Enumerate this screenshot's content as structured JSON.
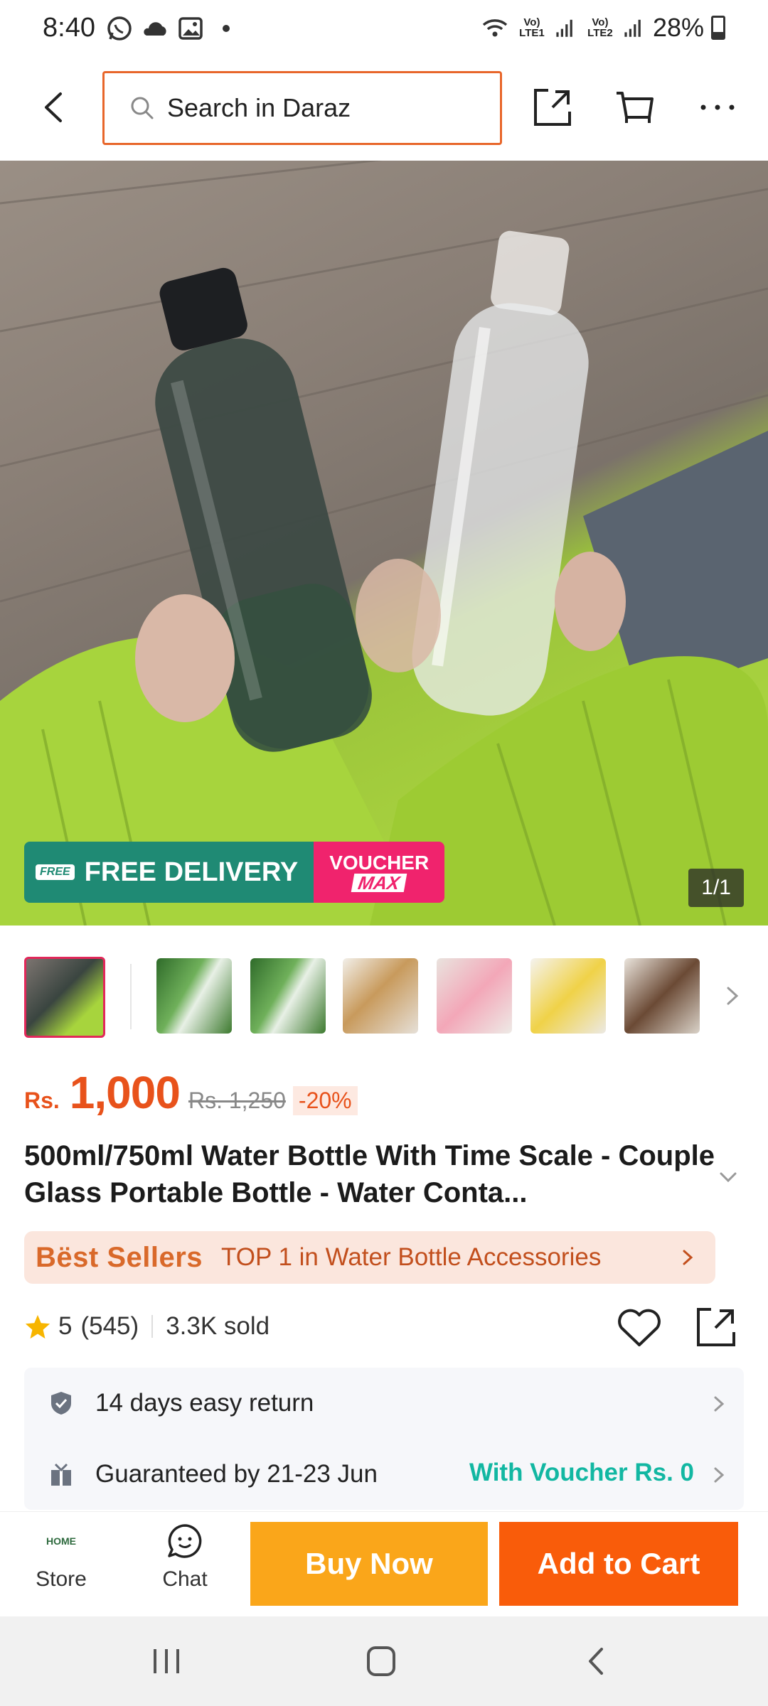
{
  "status_bar": {
    "time": "8:40",
    "battery_percent": "28%",
    "sim1_label": "Vo) LTE1",
    "sim2_label": "Vo) LTE2",
    "icons": [
      "whatsapp-icon",
      "cloud-icon",
      "gallery-icon",
      "dot-icon",
      "wifi-icon",
      "signal-icon",
      "battery-icon"
    ]
  },
  "header": {
    "search_placeholder": "Search in Daraz",
    "icons": [
      "back-icon",
      "search-icon",
      "share-icon",
      "cart-icon",
      "more-icon"
    ]
  },
  "product_image": {
    "banner_left": "FREE DELIVERY",
    "banner_free_tag": "FREE",
    "banner_voucher_line1": "VOUCHER",
    "banner_voucher_line2": "MAX",
    "counter": "1/1"
  },
  "price": {
    "currency": "Rs.",
    "current": "1,000",
    "original": "Rs. 1,250",
    "discount": "-20%"
  },
  "title": "500ml/750ml Water Bottle With Time Scale - Couple Glass Portable Bottle - Water Conta...",
  "bestseller": {
    "badge": "Bëst Sellers",
    "text": "TOP 1 in Water Bottle Accessories"
  },
  "rating": {
    "score": "5",
    "count": "(545)",
    "sold": "3.3K sold"
  },
  "info": {
    "return_text": "14 days easy return",
    "delivery_text": "Guaranteed by 21-23 Jun",
    "voucher_text": "With Voucher Rs. 0"
  },
  "bottom_bar": {
    "store_label": "Store",
    "store_logo_text": "HOME",
    "chat_label": "Chat",
    "buy_now": "Buy Now",
    "add_to_cart": "Add to Cart"
  },
  "colors": {
    "accent_orange": "#f95c0a",
    "buy_now_yellow": "#faa61a",
    "price_orange": "#e8521b",
    "voucher_teal": "#12b7a2",
    "banner_green": "#1f8a74",
    "banner_pink": "#f0236d"
  }
}
